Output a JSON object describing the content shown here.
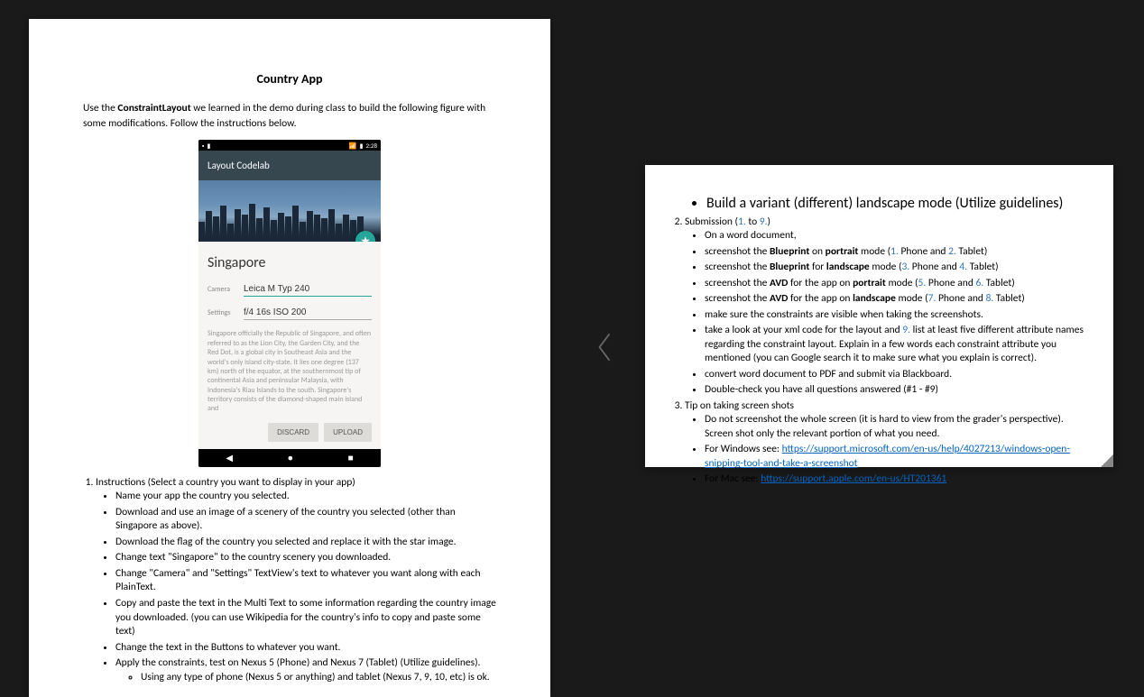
{
  "page1": {
    "title": "Country App",
    "intro_pre": "Use the ",
    "intro_bold": "ConstraintLayout",
    "intro_post": " we learned in the demo during class to build the following figure with some modifications. Follow the instructions below.",
    "phone": {
      "time": "2:28",
      "appbar": "Layout Codelab",
      "city": "Singapore",
      "camera_label": "Camera",
      "camera_value": "Leica M Typ 240",
      "settings_label": "Settings",
      "settings_value": "f/4 16s ISO 200",
      "desc": "Singapore officially the Republic of Singapore, and often referred to as the Lion City, the Garden City, and the Red Dot, is a global city in Southeast Asia and the world's only island city-state. It lies one degree (137 km) north of the equator, at the southernmost tip of continental Asia and peninsular Malaysia, with Indonesia's Riau Islands to the south. Singapore's territory consists of the diamond-shaped main island and",
      "btn_discard": "DISCARD",
      "btn_upload": "UPLOAD"
    },
    "list1_header": "Instructions (Select a country you want to display in your app)",
    "bullets": [
      "Name your app the country you selected.",
      "Download and use an image of a scenery of the country you selected (other than Singapore as above).",
      "Download the flag of the country you selected and replace it with the star image.",
      "Change text \"Singapore\" to the country scenery you downloaded.",
      "Change \"Camera\" and \"Settings\" TextView's text to whatever you want along with each PlainText.",
      "Copy and paste the text in the Multi Text to some information regarding the country image you downloaded. (you can use Wikipedia for the country's info to copy and paste some text)",
      "Change the text in the Buttons to whatever you want.",
      "Apply the constraints, test on Nexus 5 (Phone) and Nexus 7 (Tablet) (Utilize guidelines)."
    ],
    "subbullet": "Using any type of phone (Nexus 5 or anything) and tablet (Nexus 7, 9, 10, etc) is ok."
  },
  "page2": {
    "top_bullet": "Build a variant (different) landscape mode (Utilize guidelines)",
    "submission": {
      "pre": "Submission (",
      "n1": "1.",
      "mid": " to ",
      "n9": "9.",
      "post": ")"
    },
    "sub_b1": "On a word document,",
    "sub_b2": {
      "pre": "screenshot the ",
      "b": "Blueprint",
      "mid": " on ",
      "b2": "portrait",
      "post": " mode (",
      "n1": "1.",
      "t1": " Phone and ",
      "n2": "2.",
      "t2": " Tablet)"
    },
    "sub_b3": {
      "pre": "screenshot the ",
      "b": "Blueprint",
      "mid": " for ",
      "b2": "landscape",
      "post": " mode (",
      "n1": "3.",
      "t1": " Phone and ",
      "n2": "4.",
      "t2": " Tablet)"
    },
    "sub_b4": {
      "pre": "screenshot the ",
      "b": "AVD",
      "mid": " for the app on ",
      "b2": "portrait",
      "post": " mode (",
      "n1": "5.",
      "t1": " Phone and ",
      "n2": "6.",
      "t2": " Tablet)"
    },
    "sub_b5": {
      "pre": "screenshot the ",
      "b": "AVD",
      "mid": " for the app on ",
      "b2": "landscape",
      "post": " mode (",
      "n1": "7.",
      "t1": " Phone and ",
      "n2": "8.",
      "t2": " Tablet)"
    },
    "sub_b6": "make sure the constraints are visible when taking the screenshots.",
    "sub_b7": {
      "pre": "take a look at your xml code for the layout and ",
      "n": "9.",
      "post": " list at least five different attribute names regarding the constraint layout. Explain in a few words each constraint attribute you mentioned (you can Google search it to make sure what you explain is correct)."
    },
    "sub_b8": "convert word document to PDF and submit via Blackboard.",
    "sub_b9": "Double-check you have all questions answered (#1 - #9)",
    "tip_header": "Tip on taking screen shots",
    "tip_b1": "Do not screenshot the whole screen (it is hard to view from the grader's perspective). Screen shot only the relevant portion of what you need.",
    "tip_b2_pre": "For Windows see: ",
    "tip_b2_link": "https://support.microsoft.com/en-us/help/4027213/windows-open-snipping-tool-and-take-a-screenshot",
    "tip_b3_pre": "For Mac see: ",
    "tip_b3_link": "https://support.apple.com/en-us/HT201361"
  }
}
